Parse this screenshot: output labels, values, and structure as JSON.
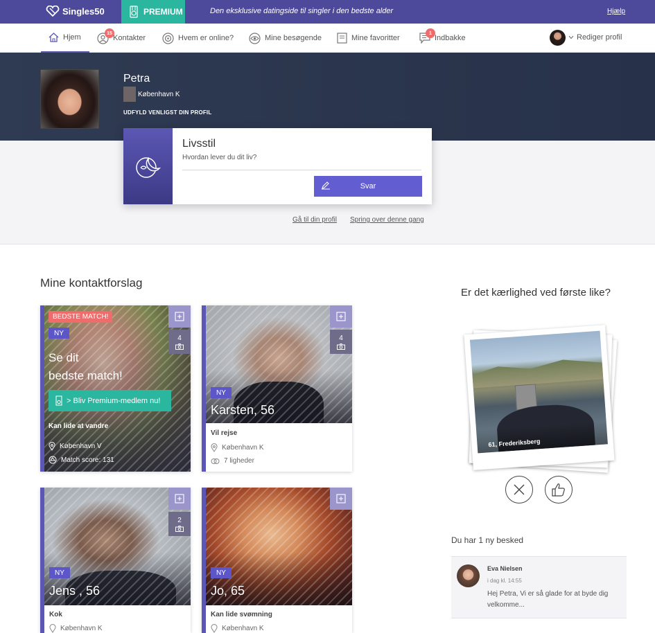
{
  "topbar": {
    "brand": "Singles50",
    "premium": "PREMIUM",
    "slogan": "Den eksklusive datingside til singler i den bedste alder",
    "help": "Hjælp"
  },
  "nav": {
    "items": [
      {
        "label": "Hjem",
        "icon": "home-icon",
        "active": true
      },
      {
        "label": "Kontakter",
        "icon": "contacts-icon",
        "badge": "15"
      },
      {
        "label": "Hvem er online?",
        "icon": "online-icon"
      },
      {
        "label": "Mine besøgende",
        "icon": "eye-icon"
      },
      {
        "label": "Mine favoritter",
        "icon": "bookmark-icon"
      },
      {
        "label": "Indbakke",
        "icon": "message-icon",
        "badge": "1"
      }
    ],
    "edit_profile": "Rediger profil"
  },
  "profile": {
    "name": "Petra",
    "city": "København K",
    "hint": "UDFYLD VENLIGST DIN PROFIL"
  },
  "question": {
    "title": "Livsstil",
    "subtitle": "Hvordan lever du dit liv?",
    "answer_label": "Svar",
    "icon": "moon-icon"
  },
  "profile_links": {
    "goto": "Gå til din profil",
    "skip": "Spring over denne gang"
  },
  "suggestions": {
    "title": "Mine kontaktforslag",
    "best_match": {
      "badge": "BEDSTE MATCH!",
      "new": "NY",
      "headline_1": "Se dit",
      "headline_2": "bedste match!",
      "cta": "> Bliv Premium-medlem nu!",
      "tag": "Kan lide at vandre",
      "city": "København V",
      "score": "Match score: 131",
      "photos": "4"
    },
    "cards": [
      {
        "name": "Karsten, 56",
        "new": "NY",
        "photos": "4",
        "tag": "Vil rejse",
        "city": "København K",
        "extra": "7 ligheder"
      },
      {
        "name": "Jens , 56",
        "new": "NY",
        "photos": "2",
        "tag": "Kok",
        "city": "København K"
      },
      {
        "name": "Jo, 65",
        "new": "NY",
        "tag": "Kan lide svømning",
        "city": "København K"
      }
    ]
  },
  "love": {
    "title": "Er det kærlighed ved første like?",
    "caption": "61, Frederiksberg"
  },
  "messages": {
    "title": "Du har 1 ny besked",
    "sender": "Eva Nielsen",
    "time": "i dag kl. 14:55",
    "text": "Hej Petra, Vi er så glade for at byde dig velkomme..."
  },
  "colors": {
    "primary": "#4e4a9b",
    "accent": "#2bb79f",
    "badge": "#ef6c6c",
    "hero": "#2f3b52"
  }
}
